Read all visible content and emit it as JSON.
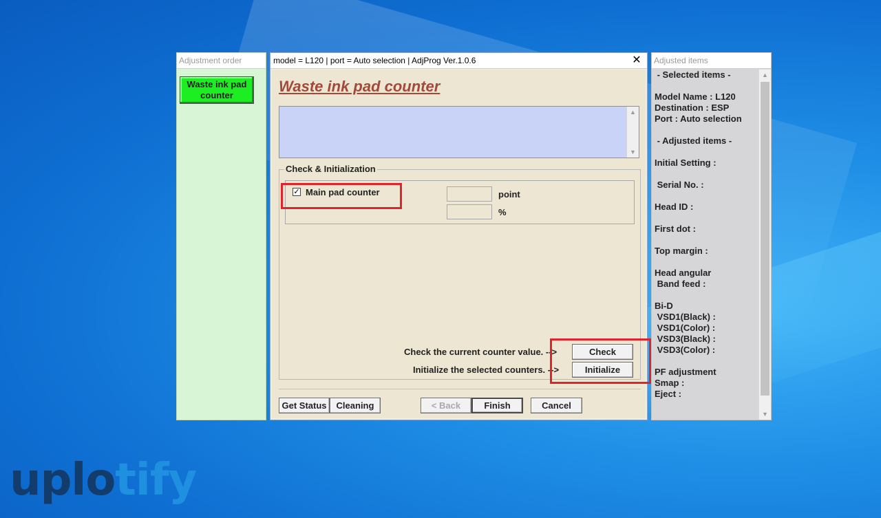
{
  "left_panel": {
    "header": "Adjustment order",
    "button_label": "Waste ink pad counter"
  },
  "dialog": {
    "title": "model = L120 | port = Auto selection | AdjProg Ver.1.0.6",
    "close_glyph": "✕",
    "heading": "Waste ink pad counter",
    "group_title": "Check & Initialization",
    "checkbox_checked": true,
    "checkbox_label": "Main pad counter",
    "unit_point": "point",
    "unit_percent": "%",
    "check_text": "Check the current counter value.  -->",
    "init_text": "Initialize the selected counters.  -->",
    "check_button": "Check",
    "initialize_button": "Initialize",
    "get_status_button": "Get Status",
    "cleaning_button": "Cleaning",
    "back_button": "< Back",
    "finish_button": "Finish",
    "cancel_button": "Cancel"
  },
  "right_panel": {
    "header": "Adjusted items",
    "lines": [
      " - Selected items -",
      "",
      "Model Name : L120",
      "Destination : ESP",
      "Port : Auto selection",
      "",
      " - Adjusted items -",
      "",
      "Initial Setting :",
      "",
      " Serial No. :",
      "",
      "Head ID :",
      "",
      "First dot :",
      "",
      "Top margin :",
      "",
      "Head angular",
      " Band feed :",
      "",
      "Bi-D",
      " VSD1(Black) :",
      " VSD1(Color) :",
      " VSD3(Black) :",
      " VSD3(Color) :",
      "",
      "PF adjustment",
      "Smap :",
      "Eject :"
    ]
  },
  "watermark": {
    "part1": "uplo",
    "part2": "tify"
  },
  "colors": {
    "highlight": "#e1232c",
    "heading": "#a4483a",
    "order_button": "#1cee22",
    "message_box": "#c9d3f8"
  }
}
